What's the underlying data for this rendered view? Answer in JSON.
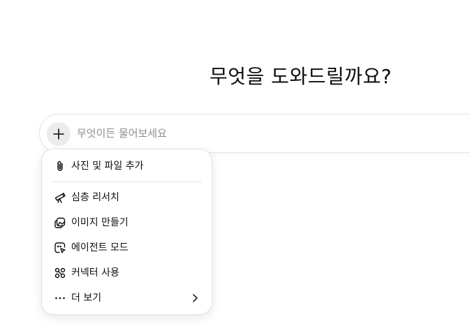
{
  "main": {
    "heading": "무엇을 도와드릴까요?"
  },
  "composer": {
    "placeholder": "무엇이든 물어보세요",
    "value": "",
    "plus_icon": "plus-icon"
  },
  "menu": {
    "items": [
      {
        "label": "사진 및 파일 추가",
        "icon": "paperclip-icon"
      },
      {
        "label": "심층 리서치",
        "icon": "telescope-icon"
      },
      {
        "label": "이미지 만들기",
        "icon": "image-create-icon"
      },
      {
        "label": "에이전트 모드",
        "icon": "agent-cursor-icon"
      },
      {
        "label": "커넥터 사용",
        "icon": "connectors-icon"
      },
      {
        "label": "더 보기",
        "icon": "more-horizontal-icon",
        "trailing_icon": "chevron-right-icon"
      }
    ]
  }
}
